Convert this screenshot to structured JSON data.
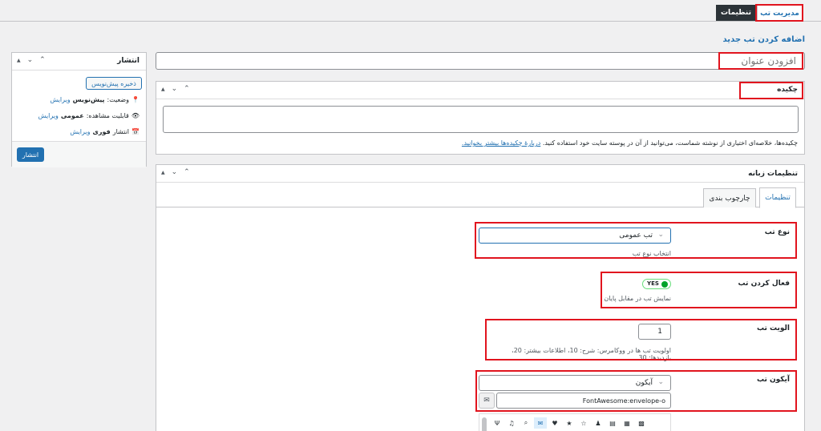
{
  "tabs": {
    "settings": "تنظیمات",
    "tab_manage": "مدیریت تب"
  },
  "page_title": "اضافه کردن تب جدید",
  "title_input": {
    "placeholder": "افزودن عنوان"
  },
  "publish": {
    "title": "انتشار",
    "save_draft": "ذخیره پیش‌نویس",
    "status_label": "وضعیت:",
    "status_value": "پیش‌نویس",
    "visibility_label": "قابلیت مشاهده:",
    "visibility_value": "عمومی",
    "publish_label": "انتشار",
    "publish_value": "فوری",
    "edit": "ویرایش",
    "publish_button": "انتشار"
  },
  "excerpt": {
    "title": "چکیده",
    "help_text": "چکیده‌ها، خلاصه‌ای اختیاری از نوشته شماست، می‌توانید از آن در پوسته سایت خود استفاده کنید.",
    "help_link": "دربارهٔ چکیده‌ها بیشتر بخوانید."
  },
  "tab_settings": {
    "title": "تنظیمات زبانه",
    "subtabs": [
      "تنظیمات",
      "چارچوب بندی"
    ],
    "tab_type": {
      "label": "نوع تب",
      "value": "تب عمومی",
      "desc": "انتخاب نوع تب"
    },
    "activate": {
      "label": "فعال کردن تب",
      "toggle": "YES",
      "desc": "نمایش تب در مقابل پایان"
    },
    "priority": {
      "label": "الویت تب",
      "value": "1",
      "desc": "اولویت تب ها در ووکامرس: شرح: 10، اطلاعات بیشتر: 20، بازدیدها: 30"
    },
    "icon": {
      "label": "آیکون تب",
      "select_value": "آیکون",
      "icon_value": "FontAwesome:envelope-o"
    }
  },
  "colors": {
    "accent": "#2271b1",
    "highlight": "#e1141e",
    "toggle_on": "#00a32a"
  }
}
